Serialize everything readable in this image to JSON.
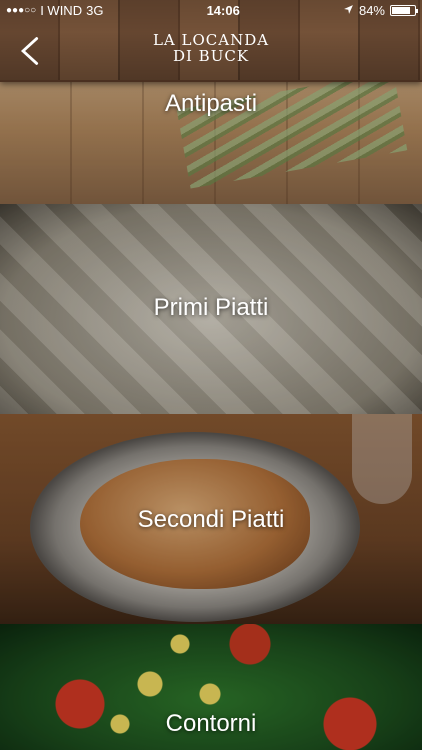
{
  "status": {
    "carrier": "I WIND",
    "network": "3G",
    "time": "14:06",
    "battery": "84%",
    "battery_level": 0.84,
    "signal_dots": "●●●○○"
  },
  "header": {
    "logo_line1": "LA LOCANDA",
    "logo_line2": "DI BUCK"
  },
  "categories": [
    {
      "label": "Antipasti"
    },
    {
      "label": "Primi Piatti"
    },
    {
      "label": "Secondi Piatti"
    },
    {
      "label": "Contorni"
    }
  ]
}
